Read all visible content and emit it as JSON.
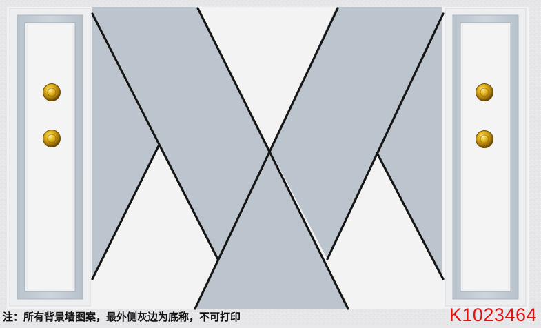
{
  "footer": {
    "note": "注：所有背景墙图案，最外侧灰边为底称，不可打印",
    "product_code": "K1023464"
  },
  "colors": {
    "outer_gray": "#e6e6e8",
    "panel_white": "#f3f3f4",
    "panel_gray": "#bcc5cd",
    "frame_blue": "#c3ccd4",
    "stripe_line": "#151515",
    "note_text": "#111111",
    "code_red": "#e11212",
    "knob_gold": "#d6a20f"
  }
}
